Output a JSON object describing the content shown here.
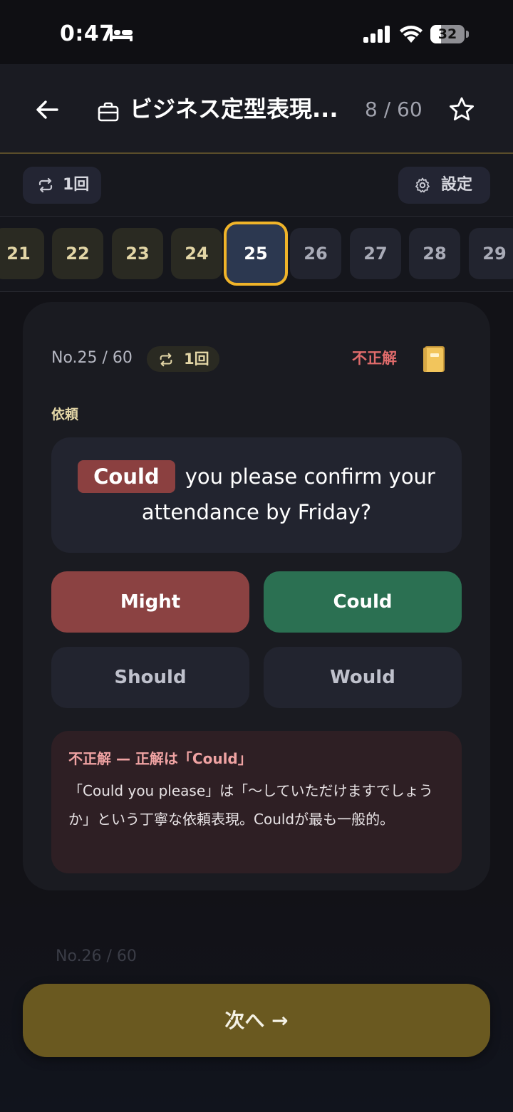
{
  "status_bar": {
    "time": "0:47",
    "battery": "32",
    "battery_level": 0.32
  },
  "header": {
    "title": "ビジネス定型表現...",
    "progress": "8 / 60"
  },
  "toolbar": {
    "repeat_label": "1回",
    "settings_label": "設定"
  },
  "strip": {
    "items": [
      {
        "label": "21",
        "state": "done"
      },
      {
        "label": "22",
        "state": "done"
      },
      {
        "label": "23",
        "state": "done"
      },
      {
        "label": "24",
        "state": "done"
      },
      {
        "label": "25",
        "state": "current"
      },
      {
        "label": "26",
        "state": "todo"
      },
      {
        "label": "27",
        "state": "todo"
      },
      {
        "label": "28",
        "state": "todo"
      },
      {
        "label": "29",
        "state": "todo"
      }
    ]
  },
  "question": {
    "number": "No.25 / 60",
    "repeat_label": "1回",
    "result": "不正解",
    "category": "依頼",
    "blank_answer": "Could",
    "sentence_rest": "you please confirm your attendance by Friday?",
    "choices": [
      {
        "label": "Might",
        "state": "wrong"
      },
      {
        "label": "Could",
        "state": "correct"
      },
      {
        "label": "Should",
        "state": "neutral"
      },
      {
        "label": "Would",
        "state": "neutral"
      }
    ],
    "feedback_title": "不正解 — 正解は「Could」",
    "feedback_body": "「Could you please」は「〜していただけますでしょうか」という丁寧な依頼表現。Couldが最も一般的。"
  },
  "next_preview": "No.26 / 60",
  "next_button": "次へ →",
  "colors": {
    "accent_gold": "#f0b429",
    "wrong": "#8b4242",
    "correct": "#2b7052",
    "next_button": "#6a5920"
  }
}
